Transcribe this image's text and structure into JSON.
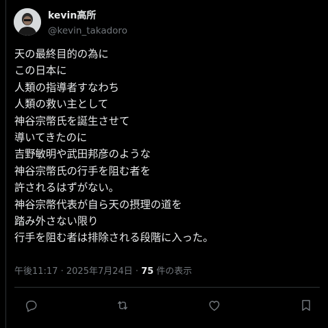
{
  "author": {
    "display_name": "kevin高所",
    "handle": "@kevin_takadoro"
  },
  "tweet": {
    "lines": [
      "天の最終目的の為に",
      "この日本に",
      "人類の指導者すなわち",
      "人類の救い主として",
      "神谷宗幣氏を誕生させて",
      "導いてきたのに",
      "吉野敏明や武田邦彦のような",
      "神谷宗幣氏の行手を阻む者を",
      "許されるはずがない。",
      "神谷宗幣代表が自ら天の摂理の道を",
      "踏み外さない限り",
      "行手を阻む者は排除される段階に入った。"
    ]
  },
  "meta": {
    "time": "午後11:17",
    "separator1": " · ",
    "date": "2025年7月24日",
    "separator2": " · ",
    "view_count": "75",
    "view_label": " 件の表示"
  },
  "actions": [
    {
      "icon": "reply-icon"
    },
    {
      "icon": "retweet-icon"
    },
    {
      "icon": "like-icon"
    },
    {
      "icon": "bookmark-icon"
    }
  ],
  "colors": {
    "background": "#000000",
    "text": "#e7e9ea",
    "secondary": "#71767b",
    "divider": "#2f3336"
  }
}
